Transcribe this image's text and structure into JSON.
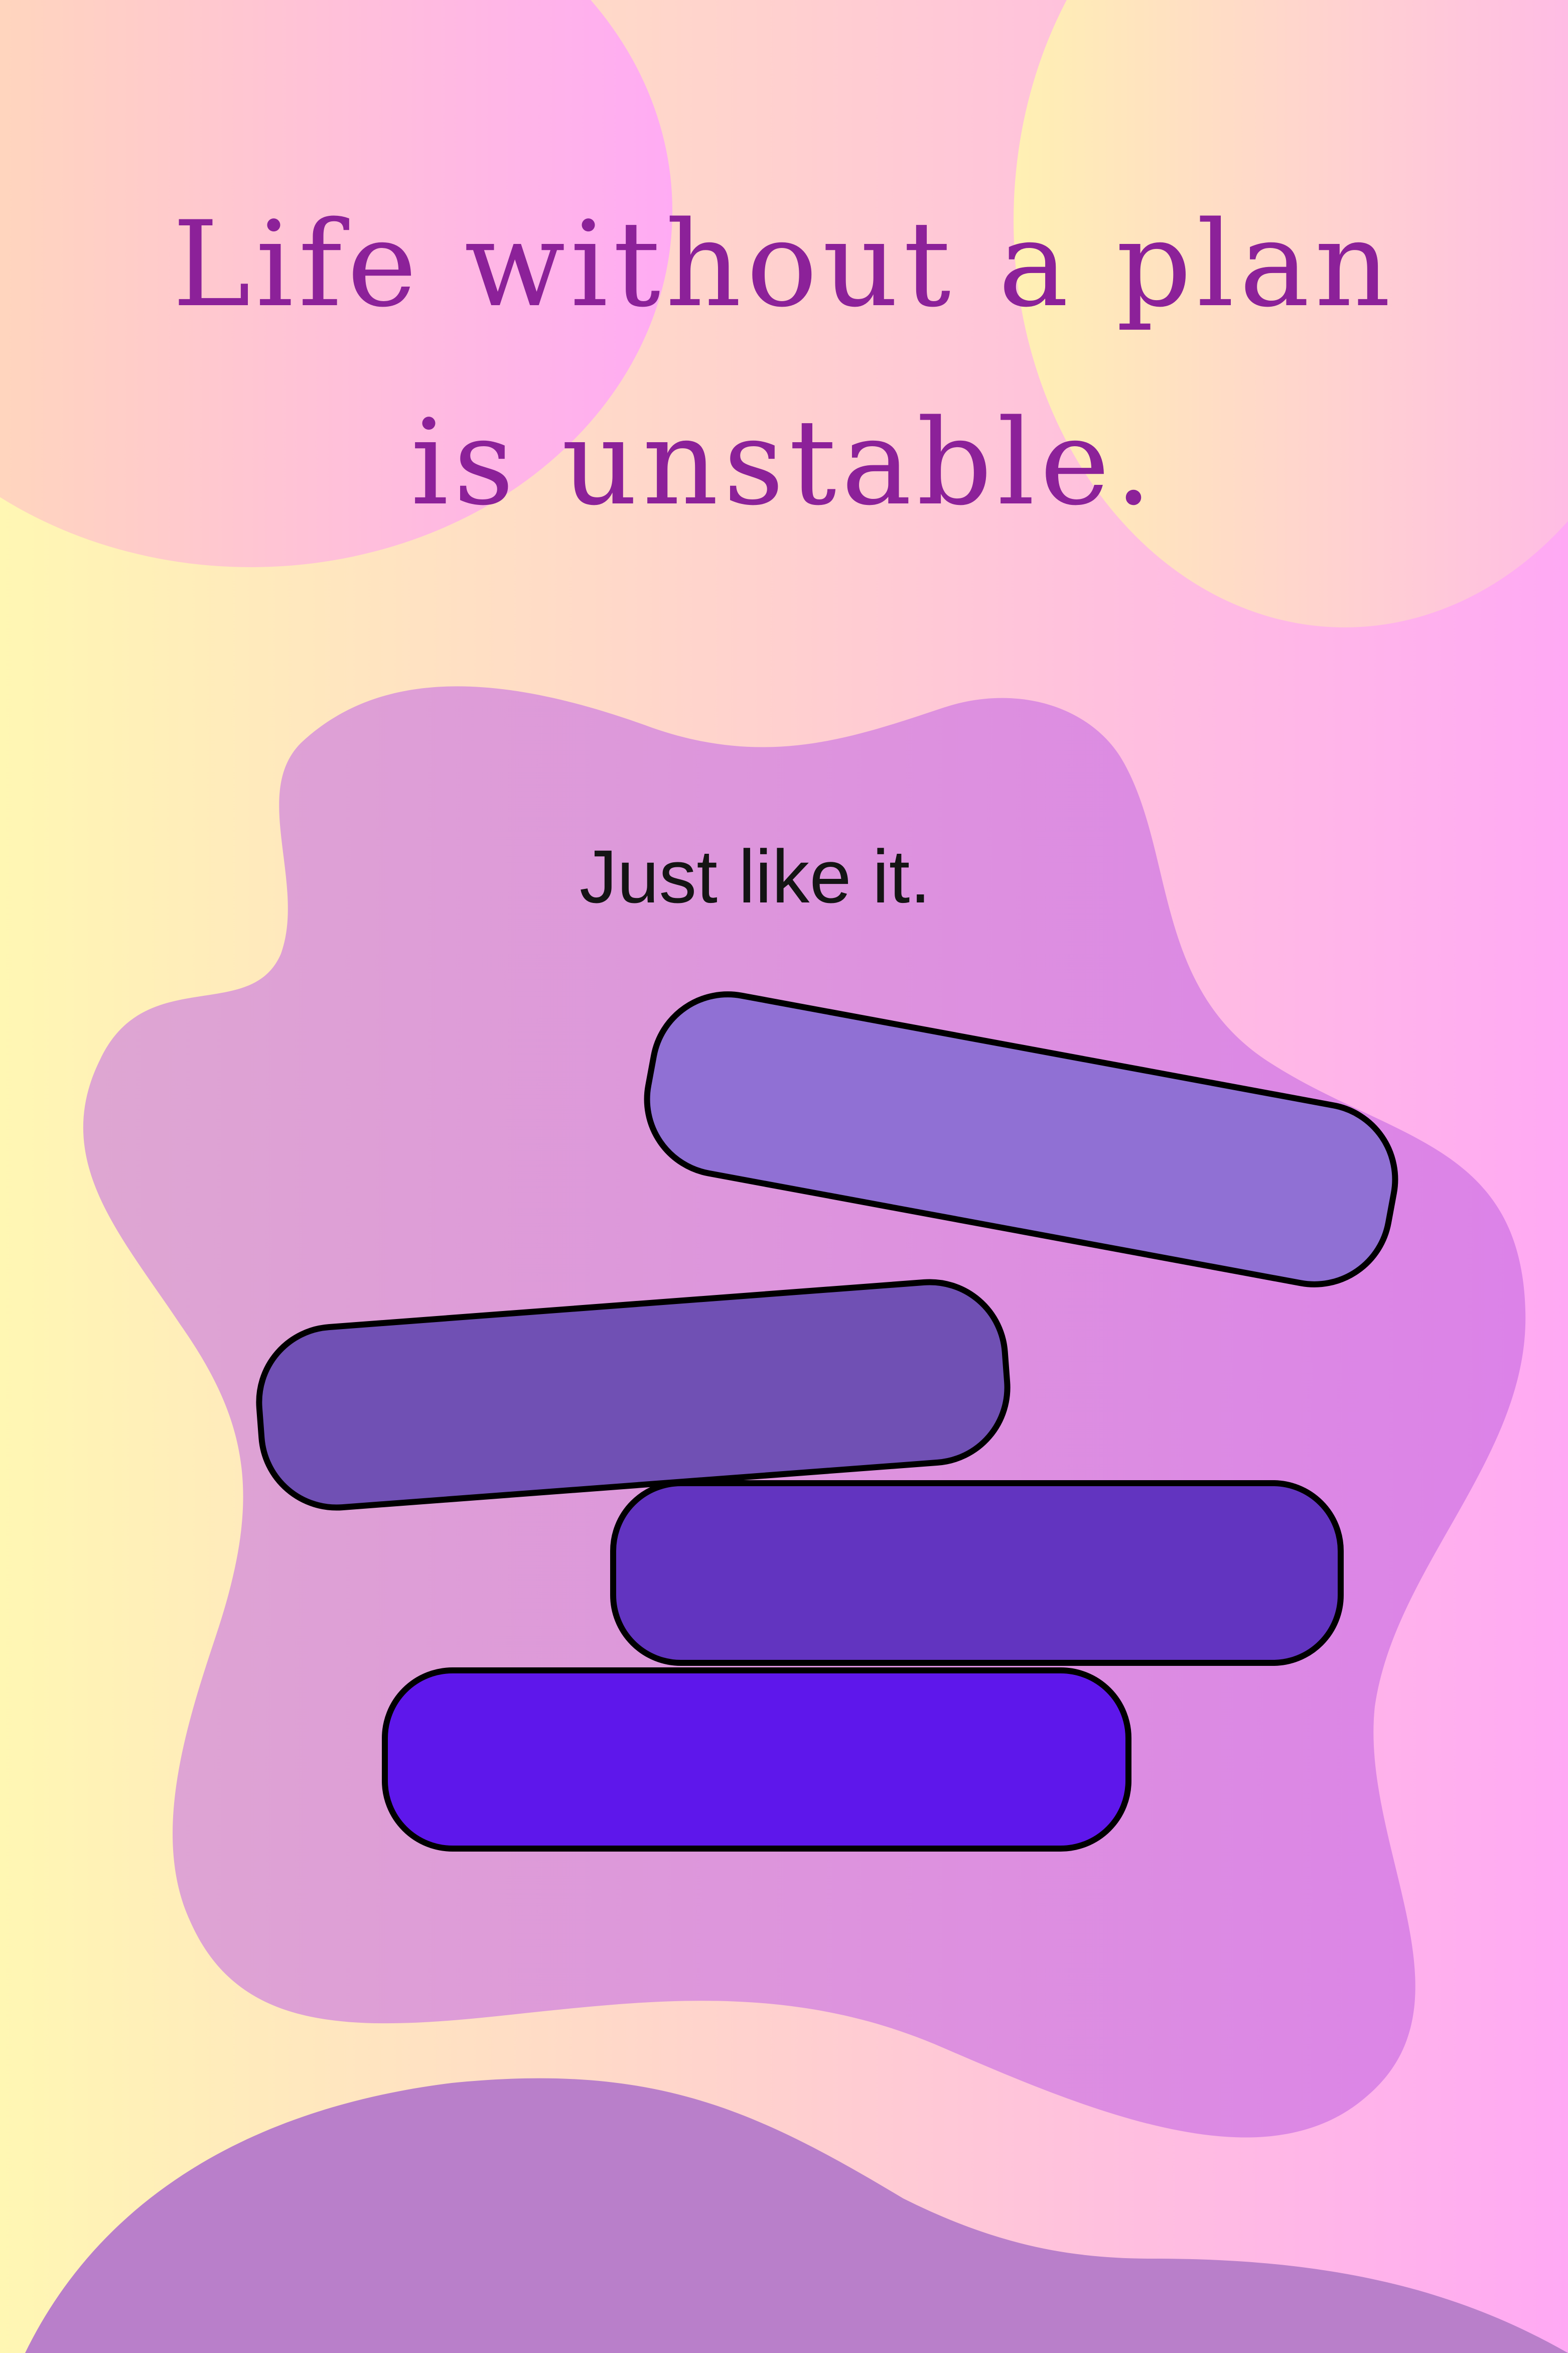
{
  "headline": "Life without a plan is unstable.",
  "subline": "Just like it.",
  "colors": {
    "bg_left": "#fff7b3",
    "bg_middle": "#ffd0cf",
    "bg_right": "#ffa9f4",
    "headline": "#8c2199",
    "blob": "#dd8be0",
    "bottom_wave": "#b97fca",
    "outline": "#000000",
    "block_top": "#9070d4",
    "block_second": "#7050b4",
    "block_third": "#6234c0",
    "block_bottom": "#5e17eb"
  }
}
